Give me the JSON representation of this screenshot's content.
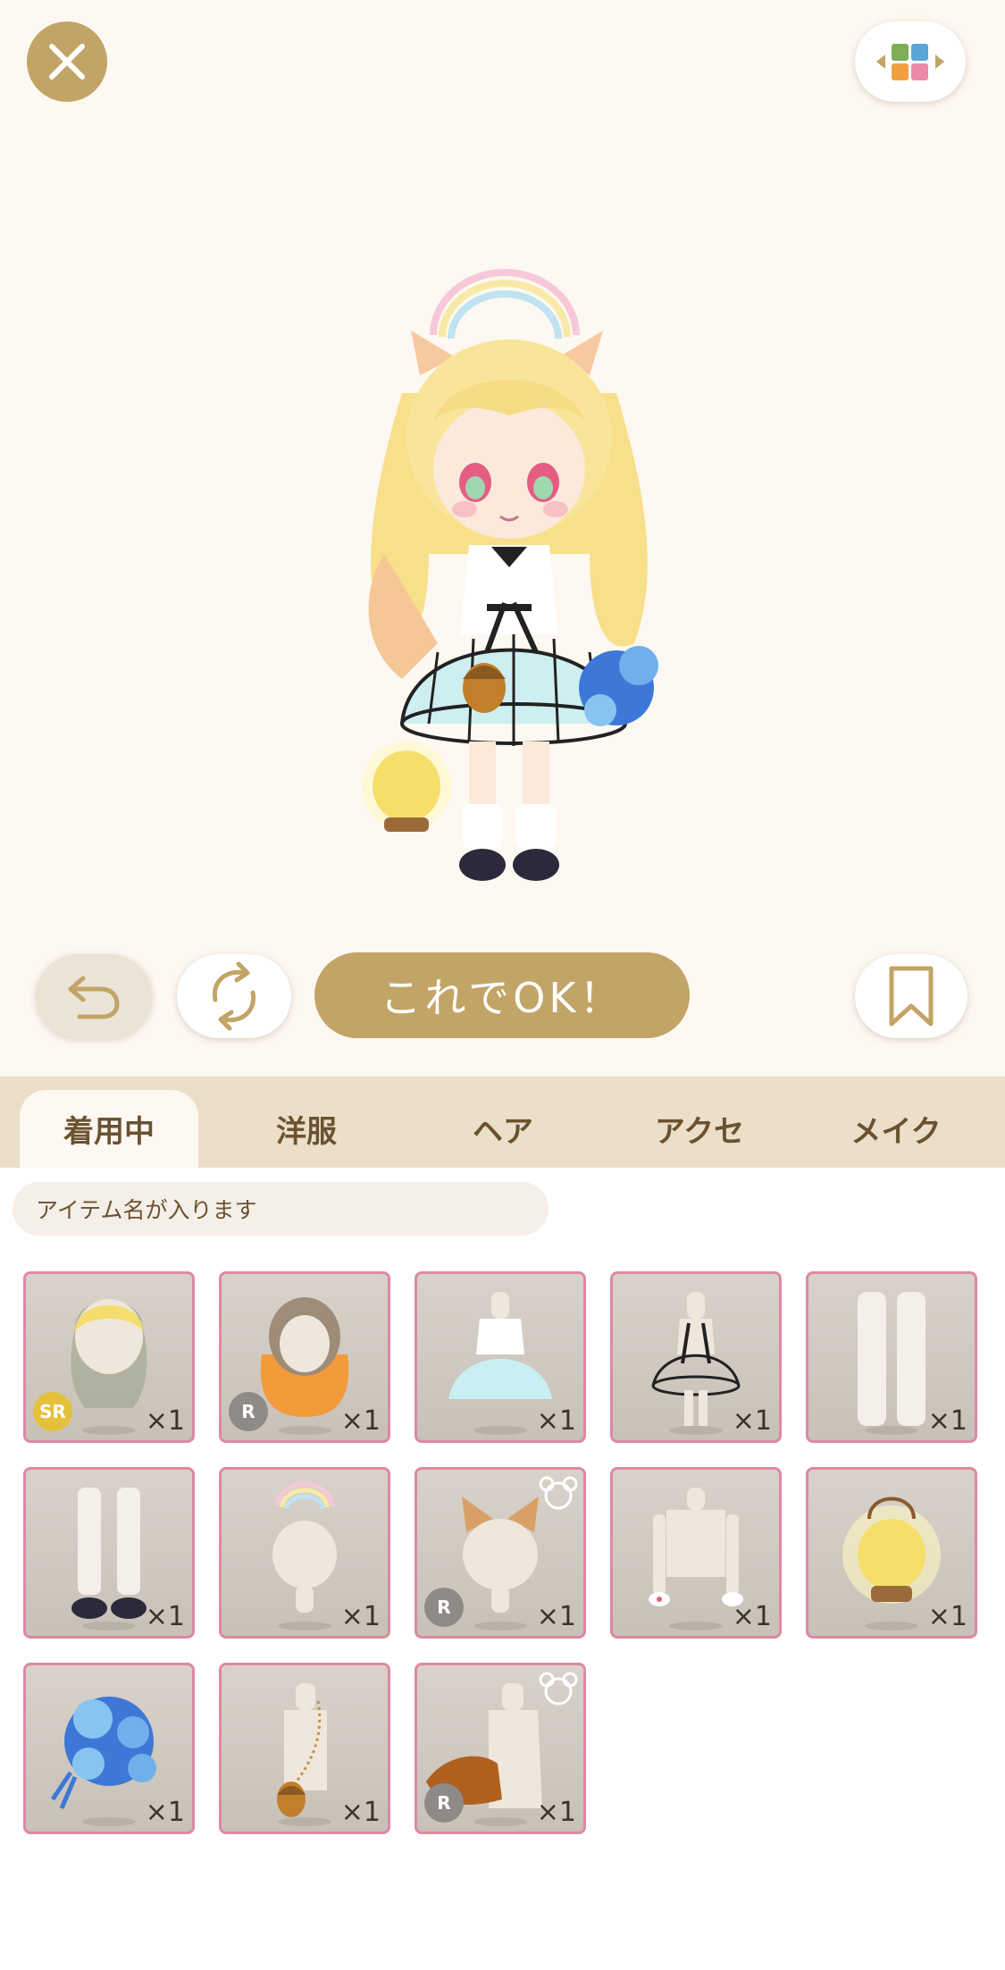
{
  "toolbar": {
    "ok_label": "これでOK！"
  },
  "tabs": [
    {
      "label": "着用中",
      "active": true
    },
    {
      "label": "洋服",
      "active": false
    },
    {
      "label": "ヘア",
      "active": false
    },
    {
      "label": "アクセ",
      "active": false
    },
    {
      "label": "メイク",
      "active": false
    }
  ],
  "search": {
    "placeholder": "アイテム名が入ります"
  },
  "items": [
    {
      "name": "blonde-braided-hair",
      "count": "×1",
      "rarity": "SR",
      "bear": false
    },
    {
      "name": "orange-long-hair",
      "count": "×1",
      "rarity": "R",
      "bear": false
    },
    {
      "name": "white-blue-dress",
      "count": "×1",
      "rarity": "",
      "bear": false
    },
    {
      "name": "cage-skirt",
      "count": "×1",
      "rarity": "",
      "bear": false
    },
    {
      "name": "white-leg-warmers",
      "count": "×1",
      "rarity": "",
      "bear": false
    },
    {
      "name": "socks-black-shoes",
      "count": "×1",
      "rarity": "",
      "bear": false
    },
    {
      "name": "rainbow-halo",
      "count": "×1",
      "rarity": "",
      "bear": false
    },
    {
      "name": "cat-ears",
      "count": "×1",
      "rarity": "R",
      "bear": true
    },
    {
      "name": "wrist-cuffs",
      "count": "×1",
      "rarity": "",
      "bear": false
    },
    {
      "name": "glowing-lantern",
      "count": "×1",
      "rarity": "",
      "bear": false
    },
    {
      "name": "blue-flower-bouquet",
      "count": "×1",
      "rarity": "",
      "bear": false
    },
    {
      "name": "acorn-pendant",
      "count": "×1",
      "rarity": "",
      "bear": false
    },
    {
      "name": "fox-tail",
      "count": "×1",
      "rarity": "R",
      "bear": true
    }
  ],
  "colors": {
    "accent": "#c2a466",
    "tab_bar": "#ebdfc9",
    "item_border": "#dc8aa3",
    "background": "#fdf8f2"
  }
}
